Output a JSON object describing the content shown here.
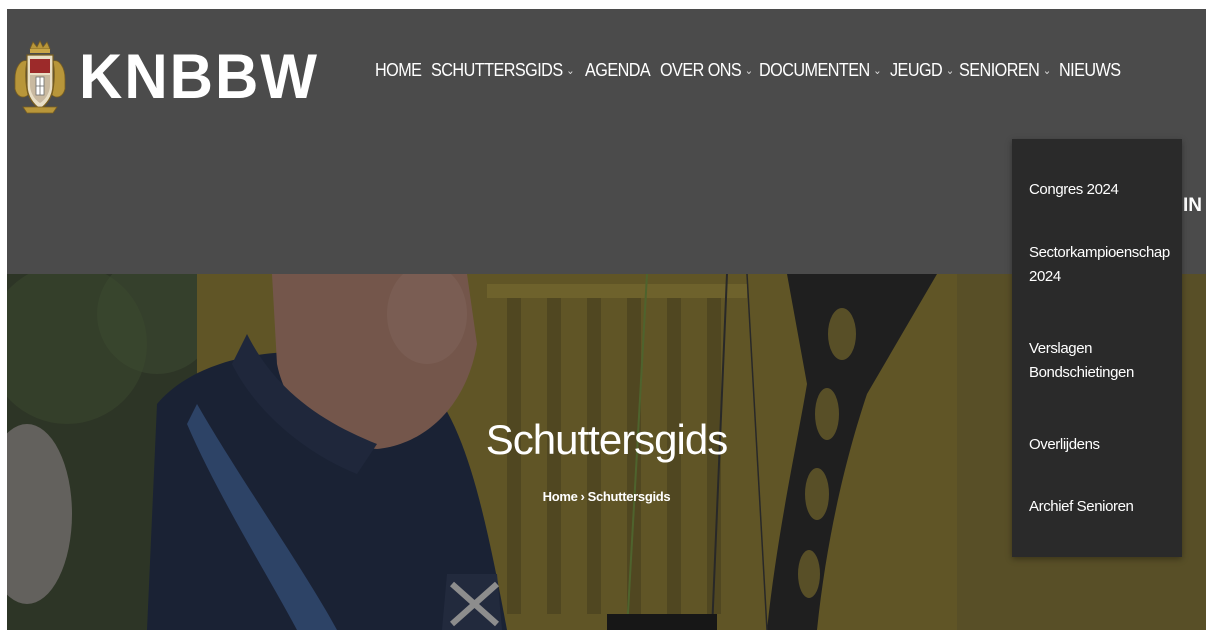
{
  "brand": {
    "name": "KNBBW",
    "logo_icon": "crest-logo-icon"
  },
  "nav": {
    "items": [
      {
        "label": "HOME",
        "has_submenu": false
      },
      {
        "label": "SCHUTTERSGIDS",
        "has_submenu": true
      },
      {
        "label": "AGENDA",
        "has_submenu": false
      },
      {
        "label": "OVER ONS",
        "has_submenu": true
      },
      {
        "label": "DOCUMENTEN",
        "has_submenu": true
      },
      {
        "label": "JEUGD",
        "has_submenu": true
      },
      {
        "label": "SENIOREN",
        "has_submenu": true
      },
      {
        "label": "NIEUWS",
        "has_submenu": false
      }
    ],
    "submenu_chevron": "⌄",
    "overflow_fragment": "IN"
  },
  "dropdown": {
    "parent": "SENIOREN",
    "items": [
      {
        "label": "Congres 2024"
      },
      {
        "label": "Sectorkampioenschap 2024"
      },
      {
        "label": "Verslagen Bondschietingen"
      },
      {
        "label": "Overlijdens"
      },
      {
        "label": "Archief Senioren"
      }
    ]
  },
  "hero": {
    "title": "Schuttersgids",
    "breadcrumb": {
      "home": "Home",
      "separator": "›",
      "current": "Schuttersgids"
    }
  },
  "colors": {
    "header_bg": "#4b4b4b",
    "dropdown_bg": "#2a2a2a",
    "text": "#ffffff",
    "crest_gold": "#b8963a",
    "crest_red": "#9c2a2a"
  }
}
